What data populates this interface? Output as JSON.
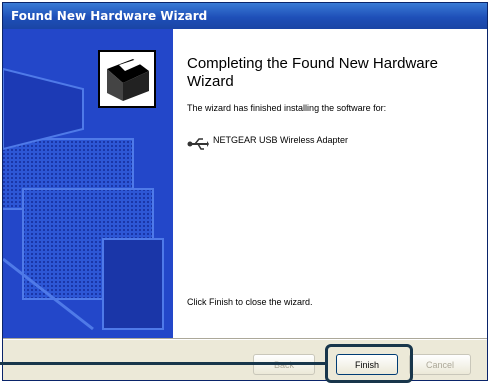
{
  "window": {
    "title": "Found New Hardware Wizard"
  },
  "content": {
    "heading": "Completing the Found New Hardware Wizard",
    "description": "The wizard has finished installing the software for:",
    "device_name": "NETGEAR USB Wireless Adapter",
    "closing": "Click Finish to close the wizard."
  },
  "buttons": {
    "back": "Back",
    "finish": "Finish",
    "cancel": "Cancel"
  },
  "colors": {
    "titlebar": "#1e4fb8",
    "panel": "#1f3fbf",
    "highlight": "#18364b"
  }
}
